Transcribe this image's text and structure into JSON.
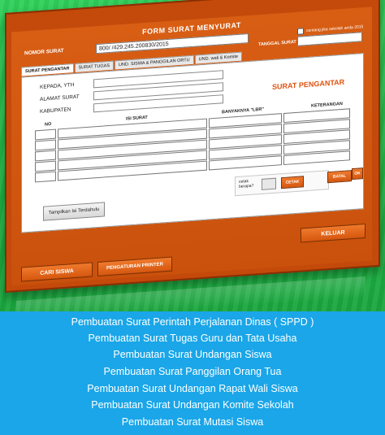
{
  "form": {
    "title": "FORM SURAT MENYURAT",
    "nomor_surat_label": "NOMOR SURAT",
    "nomor_surat_value": "800/ /429.245.200830/2015",
    "checkbox_label": "centang jika sekolah anda 2015",
    "tanggal_surat_label": "TANGGAL SURAT"
  },
  "tabs": [
    {
      "label": "SURAT PENGANTAR"
    },
    {
      "label": "SURAT TUGAS"
    },
    {
      "label": "UND. SISWA & PANGGILAN ORTU"
    },
    {
      "label": "UND. wali & Komite"
    }
  ],
  "panel": {
    "kepada_label": "KEPADA, YTH",
    "alamat_label": "ALAMAT SURAT",
    "kabupaten_label": "KABUPATEN",
    "heading": "SURAT PENGANTAR",
    "col_no": "NO",
    "col_isi": "ISI SURAT",
    "col_banyaknya": "BANYAKNYA \"LBR\"",
    "col_keterangan": "KETERANGAN",
    "tampilkan_button": "Tampilkan Isi Terdahulu",
    "cetak_berapa_label": "cetak berapa?",
    "cetak_button": "CETAK",
    "batal_button": "BATAL",
    "ok_button": "OK"
  },
  "actions": {
    "keluar_button": "KELUAR",
    "cari_siswa_button": "CARI SISWA",
    "pengaturan_printer_button": "PENGATURAN PRINTER"
  },
  "features": [
    "Pembuatan Surat Perintah Perjalanan Dinas ( SPPD )",
    "Pembuatan Surat Tugas Guru dan Tata Usaha",
    "Pembuatan Surat Undangan Siswa",
    "Pembuatan Surat Panggilan Orang Tua",
    "Pembuatan Surat Undangan Rapat Wali Siswa",
    "Pembuatan Surat Undangan Komite Sekolah",
    "Pembuatan Surat Mutasi Siswa"
  ],
  "colors": {
    "form_orange": "#c9510c",
    "accent_orange": "#e0520e",
    "green_bg": "#2fd05a",
    "blue_bg": "#1aa6e8"
  }
}
